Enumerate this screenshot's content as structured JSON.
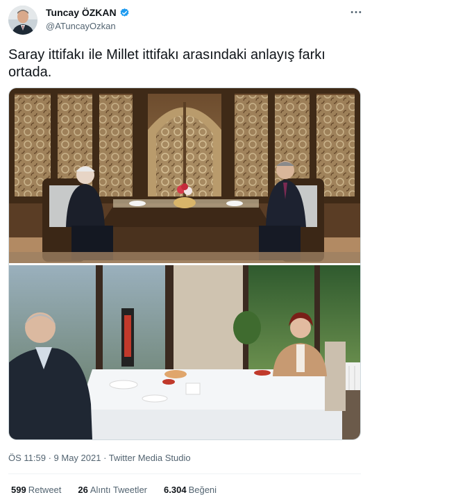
{
  "author": {
    "name": "Tuncay ÖZKAN",
    "handle": "@ATuncayOzkan",
    "verified_color": "#1d9bf0"
  },
  "tweet": {
    "text": "Saray ittifakı ile Millet ittifakı arasındaki anlayış farkı ortada.",
    "time": "ÖS 11:59",
    "separator1": " · ",
    "date": "9 May 2021",
    "separator2": " · ",
    "source": "Twitter Media Studio"
  },
  "stats": {
    "retweets_count": "599",
    "retweets_label": "Retweet",
    "quotes_count": "26",
    "quotes_label": "Alıntı Tweetler",
    "likes_count": "6.304",
    "likes_label": "Beğeni"
  },
  "icons": {
    "verified": "verified-badge-icon",
    "more": "more-options-icon"
  }
}
